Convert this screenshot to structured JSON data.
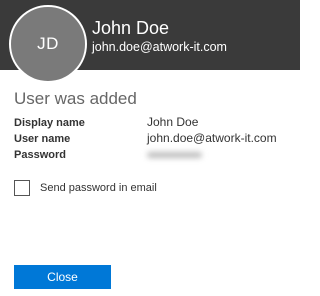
{
  "user": {
    "initials": "JD",
    "name": "John Doe",
    "email": "john.doe@atwork-it.com"
  },
  "dialog": {
    "title": "User was added",
    "fields": [
      {
        "label": "Display name",
        "value": "John Doe"
      },
      {
        "label": "User name",
        "value": "john.doe@atwork-it.com"
      },
      {
        "label": "Password",
        "value": ""
      }
    ],
    "send_email_label": "Send password in email",
    "close_label": "Close"
  },
  "colors": {
    "header_bg": "#3a3a3a",
    "avatar_bg": "#7a7a7a",
    "accent": "#0078d7"
  }
}
